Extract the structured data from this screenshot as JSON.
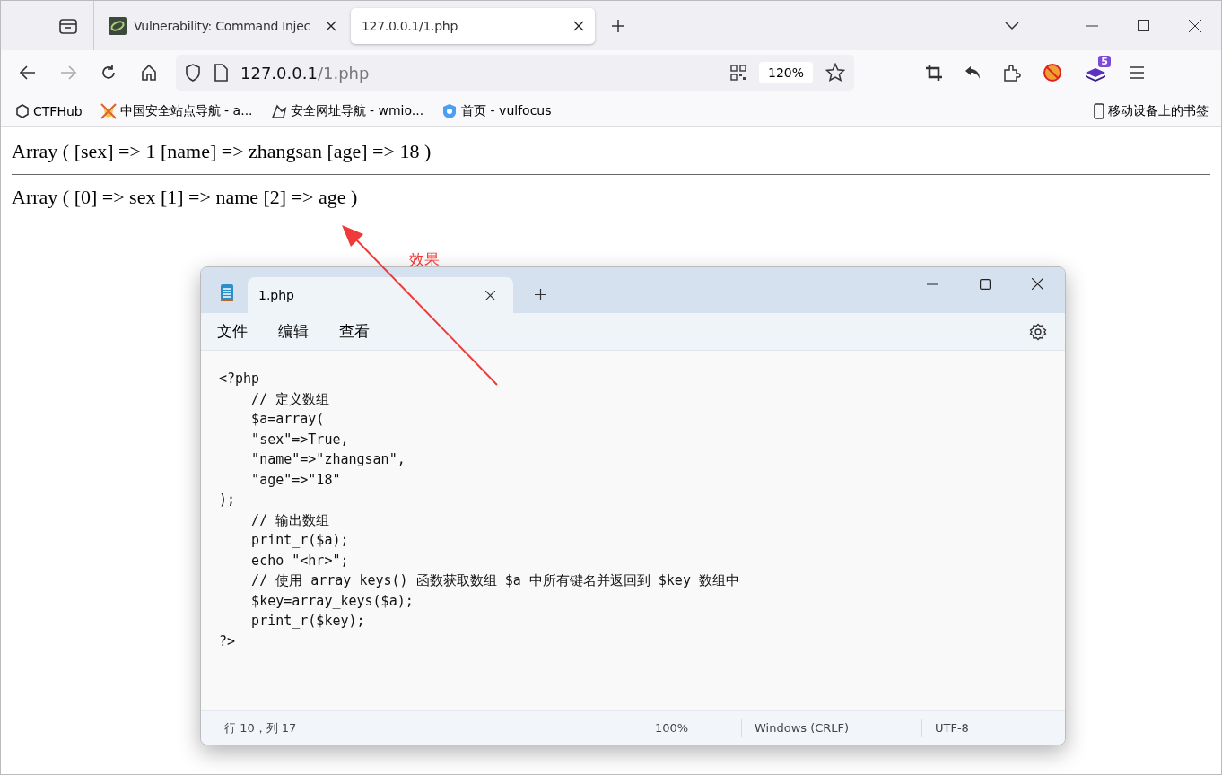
{
  "browser": {
    "tabs": [
      {
        "title": "Vulnerability: Command Injec",
        "selected": false
      },
      {
        "title": "127.0.0.1/1.php",
        "selected": true
      }
    ],
    "nav": [
      {
        "kind": "back",
        "disabled": false
      },
      {
        "kind": "forward",
        "disabled": true
      },
      {
        "kind": "reload",
        "disabled": false
      },
      {
        "kind": "home",
        "disabled": false
      }
    ],
    "url": {
      "host": "127.0.0.1",
      "path": "/1.php"
    },
    "zoom": "120%",
    "extension_badge": "5",
    "bookmarks": [
      {
        "label": "CTFHub"
      },
      {
        "label": "中国安全站点导航 - a..."
      },
      {
        "label": "安全网址导航 - wmio..."
      },
      {
        "label": "首页 - vulfocus"
      }
    ],
    "mobile_bookmarks": "移动设备上的书签"
  },
  "page": {
    "lines": [
      {
        "kind": "text",
        "text": "Array ( [sex] => 1 [name] => zhangsan [age] => 18 )"
      },
      {
        "kind": "rule"
      },
      {
        "kind": "text",
        "text": "Array ( [0] => sex [1] => name [2] => age )"
      }
    ]
  },
  "annotation": {
    "label": "效果"
  },
  "notepad": {
    "tab": "1.php",
    "menu": [
      "文件",
      "编辑",
      "查看"
    ],
    "code": [
      "<?php",
      "    // 定义数组",
      "    $a=array(",
      "    \"sex\"=>True,",
      "    \"name\"=>\"zhangsan\",",
      "    \"age\"=>\"18\"",
      ");",
      "    // 输出数组",
      "    print_r($a);",
      "    echo \"<hr>\";",
      "    // 使用 array_keys() 函数获取数组 $a 中所有键名并返回到 $key 数组中",
      "    $key=array_keys($a);",
      "    print_r($key);",
      "?>"
    ],
    "status": [
      "行 10，列 17",
      "100%",
      "Windows (CRLF)",
      "UTF-8"
    ]
  }
}
